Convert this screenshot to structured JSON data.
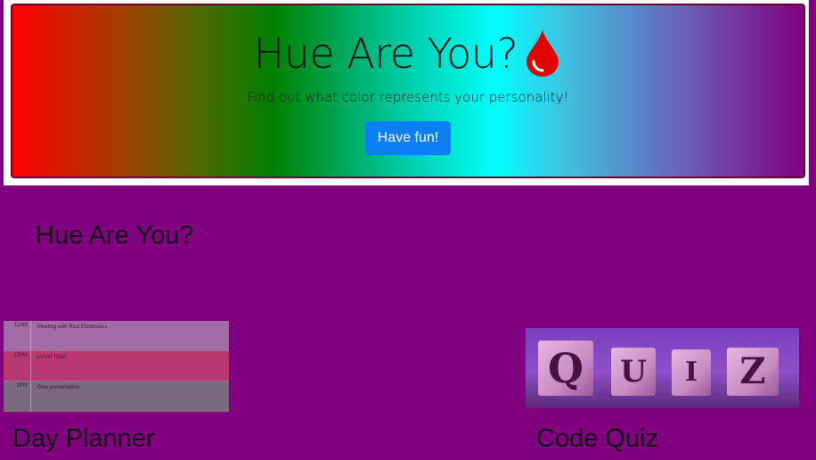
{
  "hero": {
    "title": "Hue Are You?",
    "subtitle": "Find out what color represents your personality!",
    "button_label": "Have fun!",
    "drop_color": "#e00000",
    "button_color": "#0d7ff5"
  },
  "section": {
    "title": "Hue Are You?"
  },
  "projects": [
    {
      "label": "Day Planner",
      "rows": [
        {
          "time": "11AM",
          "note": "Meeting with Rico Electronics"
        },
        {
          "time": "12PM",
          "note": "Lunch Time!"
        },
        {
          "time": "1PM",
          "note": "Give presentation"
        }
      ]
    },
    {
      "label": "Code Quiz",
      "letters": [
        "Q",
        "U",
        "I",
        "Z"
      ]
    }
  ],
  "colors": {
    "background": "#800080"
  }
}
